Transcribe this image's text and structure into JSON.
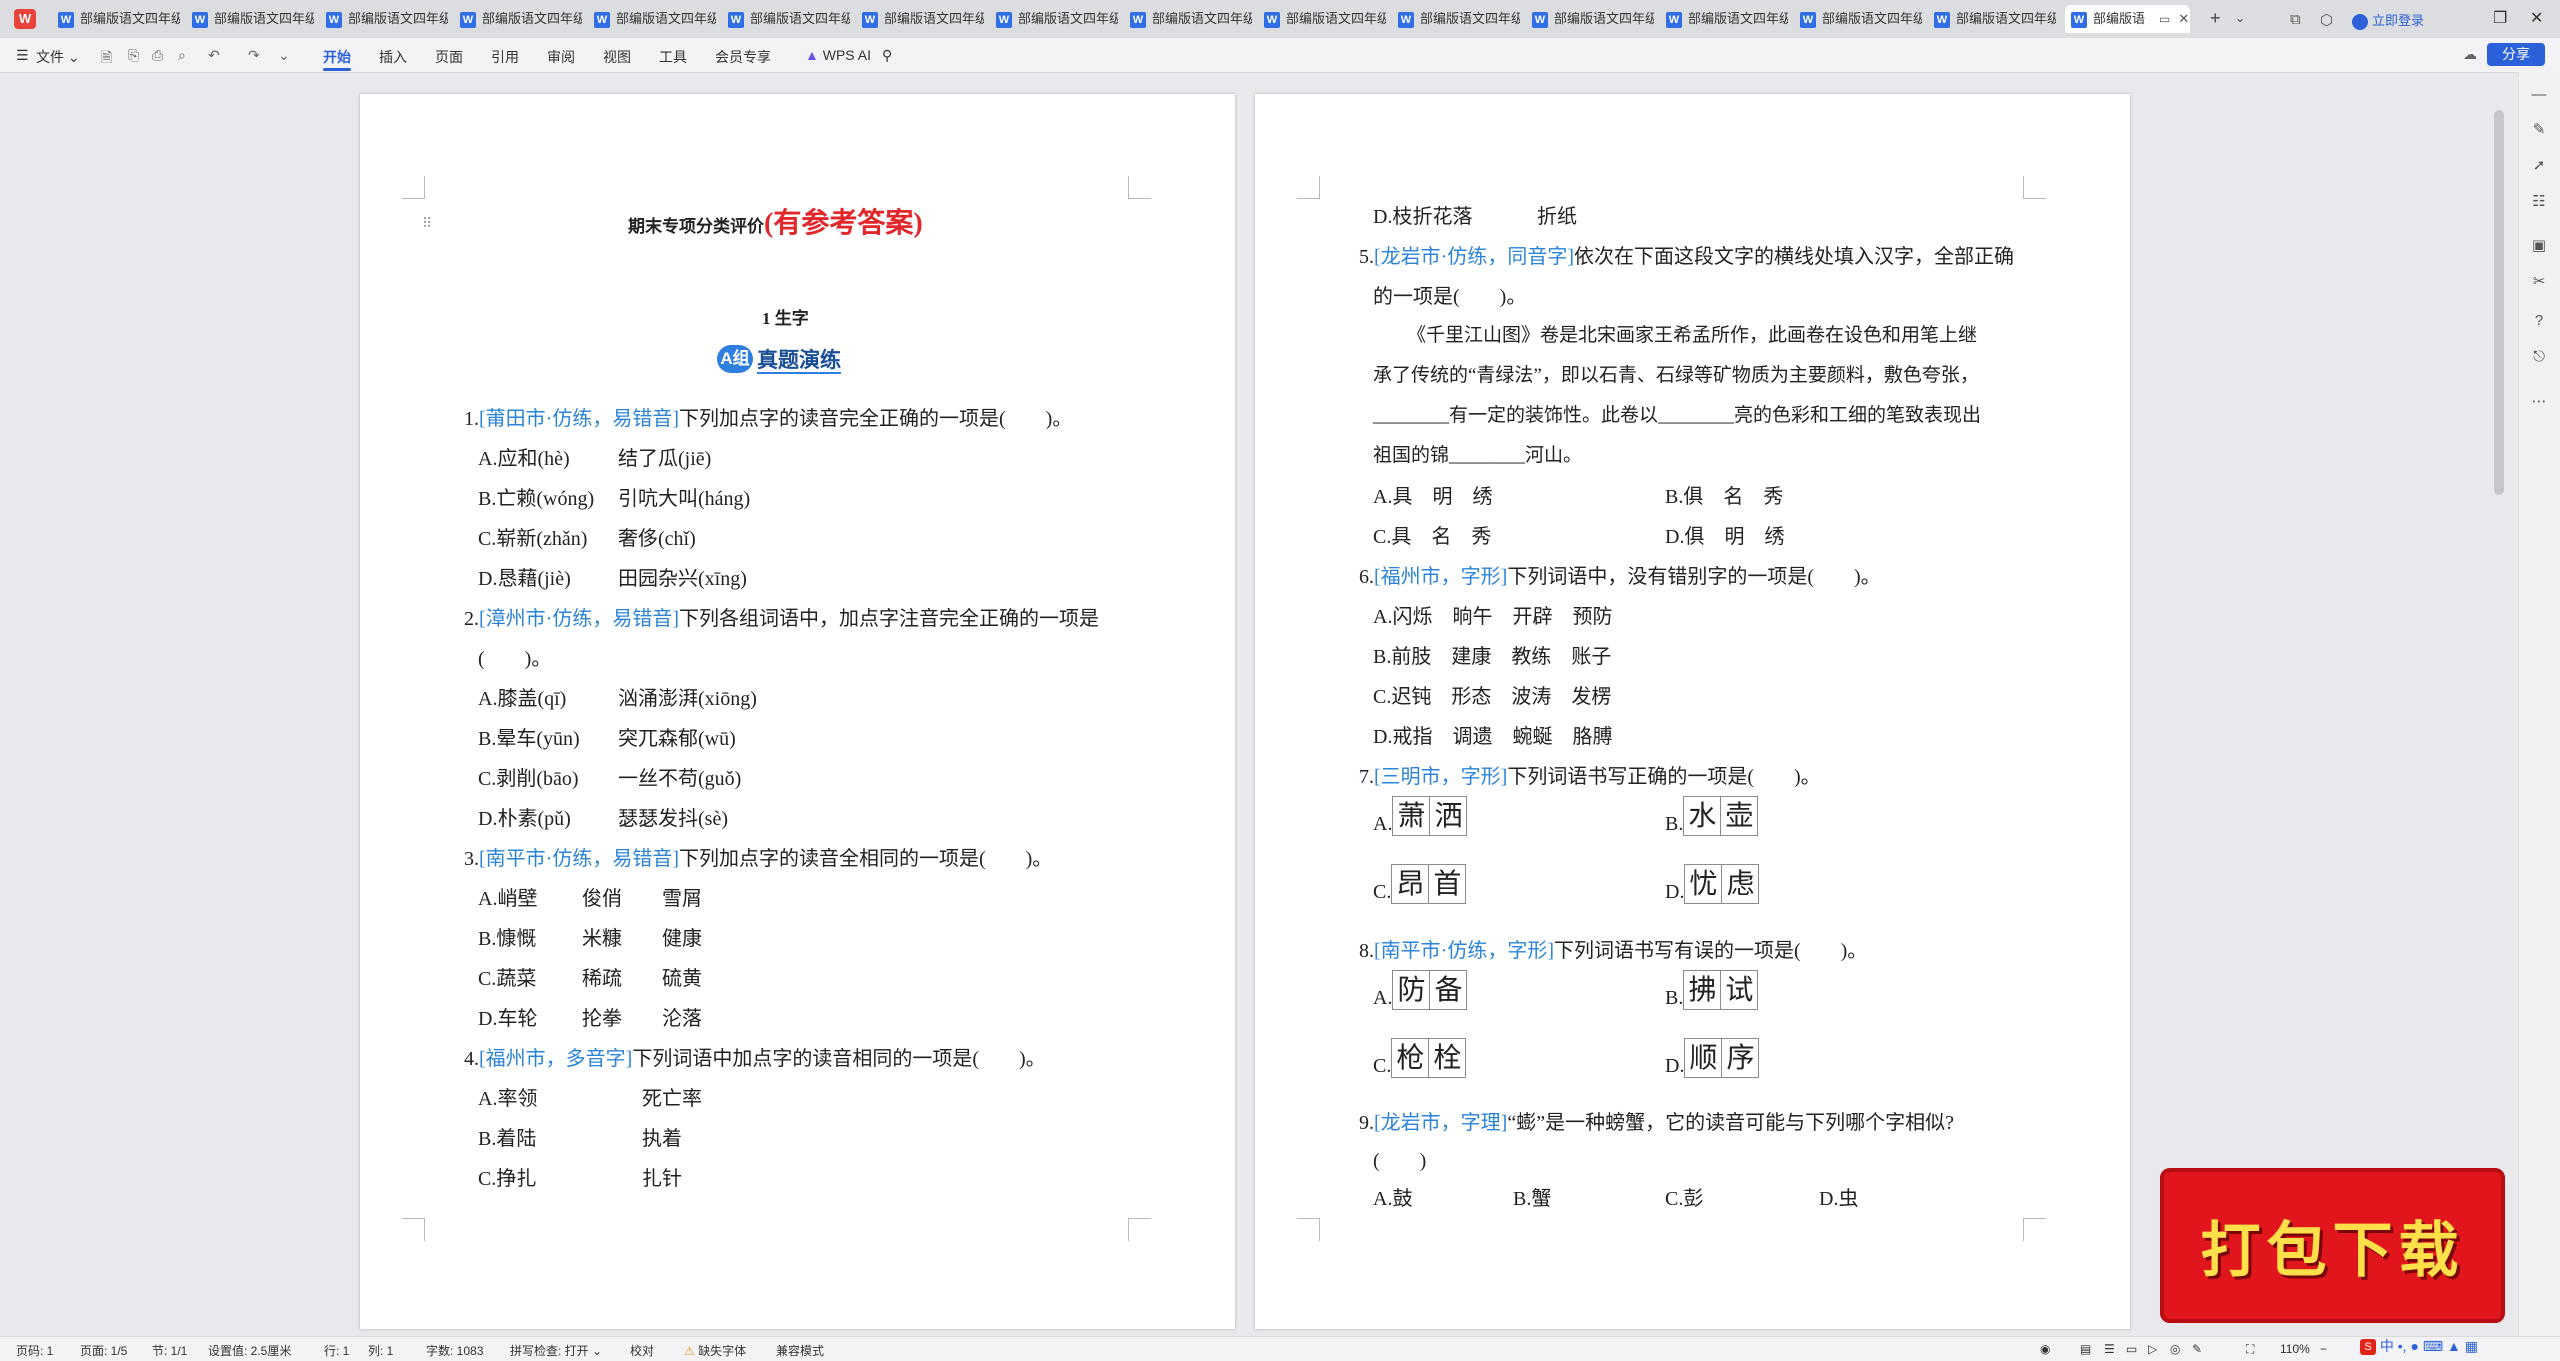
{
  "tabs": {
    "items": [
      "部编版语文四年级",
      "部编版语文四年级",
      "部编版语文四年级",
      "部编版语文四年级",
      "部编版语文四年级",
      "部编版语文四年级",
      "部编版语文四年级",
      "部编版语文四年级",
      "部编版语文四年级",
      "部编版语文四年级",
      "部编版语文四年级",
      "部编版语文四年级",
      "部编版语文四年级",
      "部编版语文四年级",
      "部编版语文四年级"
    ],
    "active": "部编版语",
    "add": "+",
    "login": "立即登录"
  },
  "menu": {
    "file": "文件",
    "items": [
      "开始",
      "插入",
      "页面",
      "引用",
      "审阅",
      "视图",
      "工具",
      "会员专享"
    ],
    "wps_ai": "WPS AI",
    "share": "分享"
  },
  "left_page": {
    "title": "期末专项分类评价",
    "title_red": "(有参考答案)",
    "section": "1  生字",
    "badge": "A组",
    "badge_text": "真题演练",
    "q1": {
      "num": "1.",
      "tag": "[莆田市·仿练，易错音]",
      "text": "下列加点字的读音完全正确的一项是(　　)。",
      "opts": [
        [
          "A.应和(hè)",
          "结了瓜(jiē)"
        ],
        [
          "B.亡赖(wóng)",
          "引吭大叫(háng)"
        ],
        [
          "C.崭新(zhǎn)",
          "奢侈(chǐ)"
        ],
        [
          "D.恳藉(jiè)",
          "田园杂兴(xīng)"
        ]
      ]
    },
    "q2": {
      "num": "2.",
      "tag": "[漳州市·仿练，易错音]",
      "text": "下列各组词语中，加点字注音完全正确的一项是",
      "text2": "(　　)。",
      "opts": [
        [
          "A.膝盖(qī)",
          "汹涌澎湃(xiōng)"
        ],
        [
          "B.晕车(yūn)",
          "突兀森郁(wū)"
        ],
        [
          "C.剥削(bāo)",
          "一丝不苟(guǒ)"
        ],
        [
          "D.朴素(pǔ)",
          "瑟瑟发抖(sè)"
        ]
      ]
    },
    "q3": {
      "num": "3.",
      "tag": "[南平市·仿练，易错音]",
      "text": "下列加点字的读音全相同的一项是(　　)。",
      "opts": [
        [
          "A.峭壁",
          "俊俏",
          "雪屑"
        ],
        [
          "B.慷慨",
          "米糠",
          "健康"
        ],
        [
          "C.蔬菜",
          "稀疏",
          "硫黄"
        ],
        [
          "D.车轮",
          "抡拳",
          "沦落"
        ]
      ]
    },
    "q4": {
      "num": "4.",
      "tag": "[福州市，多音字]",
      "text": "下列词语中加点字的读音相同的一项是(　　)。",
      "opts": [
        [
          "A.率领",
          "死亡率"
        ],
        [
          "B.着陆",
          "执着"
        ],
        [
          "C.挣扎",
          "扎针"
        ]
      ]
    }
  },
  "right_page": {
    "q4d": [
      "D.枝折花落",
      "折纸"
    ],
    "q5": {
      "num": "5.",
      "tag": "[龙岩市·仿练，同音字]",
      "text": "依次在下面这段文字的横线处填入汉字，全部正确",
      "text2": "的一项是(　　)。",
      "passage": [
        "《千里江山图》卷是北宋画家王希孟所作，此画卷在设色和用笔上继",
        "承了传统的“青绿法”，即以石青、石绿等矿物质为主要颜料，敷色夸张，",
        "________有一定的装饰性。此卷以________亮的色彩和工细的笔致表现出",
        "祖国的锦________河山。"
      ],
      "opts": [
        [
          "A.具　明　绣",
          "B.俱　名　秀"
        ],
        [
          "C.具　名　秀",
          "D.俱　明　绣"
        ]
      ]
    },
    "q6": {
      "num": "6.",
      "tag": "[福州市，字形]",
      "text": "下列词语中，没有错别字的一项是(　　)。",
      "opts": [
        "A.闪烁　晌午　开辟　预防",
        "B.前肢　建康　教练　账子",
        "C.迟钝　形态　波涛　发楞",
        "D.戒指　调遗　蜿蜒　胳膊"
      ]
    },
    "q7": {
      "num": "7.",
      "tag": "[三明市，字形]",
      "text": "下列词语书写正确的一项是(　　)。",
      "opts": [
        {
          "label": "A.",
          "chars": [
            "萧",
            "洒"
          ]
        },
        {
          "label": "B.",
          "chars": [
            "水",
            "壶"
          ]
        },
        {
          "label": "C.",
          "chars": [
            "昂",
            "首"
          ]
        },
        {
          "label": "D.",
          "chars": [
            "忧",
            "虑"
          ]
        }
      ]
    },
    "q8": {
      "num": "8.",
      "tag": "[南平市·仿练，字形]",
      "text": "下列词语书写有误的一项是(　　)。",
      "opts": [
        {
          "label": "A.",
          "chars": [
            "防",
            "备"
          ]
        },
        {
          "label": "B.",
          "chars": [
            "拂",
            "试"
          ]
        },
        {
          "label": "C.",
          "chars": [
            "枪",
            "栓"
          ]
        },
        {
          "label": "D.",
          "chars": [
            "顺",
            "序"
          ]
        }
      ]
    },
    "q9": {
      "num": "9.",
      "tag": "[龙岩市，字理]",
      "text": "“蟛”是一种螃蟹，它的读音可能与下列哪个字相似?",
      "text2": "(　　)",
      "opts": [
        "A.鼓",
        "B.蟹",
        "C.彭",
        "D.虫"
      ]
    }
  },
  "status": {
    "page": "页码: 1",
    "pages": "页面: 1/5",
    "section": "节: 1/1",
    "setting": "设置值: 2.5厘米",
    "row": "行: 1",
    "col": "列: 1",
    "words": "字数: 1083",
    "spell": "拼写检查: 打开",
    "proof": "校对",
    "font_missing": "缺失字体",
    "compat": "兼容模式",
    "zoom": "110%"
  },
  "banner": {
    "text": "打包下载"
  },
  "ime": {
    "text": "中"
  }
}
